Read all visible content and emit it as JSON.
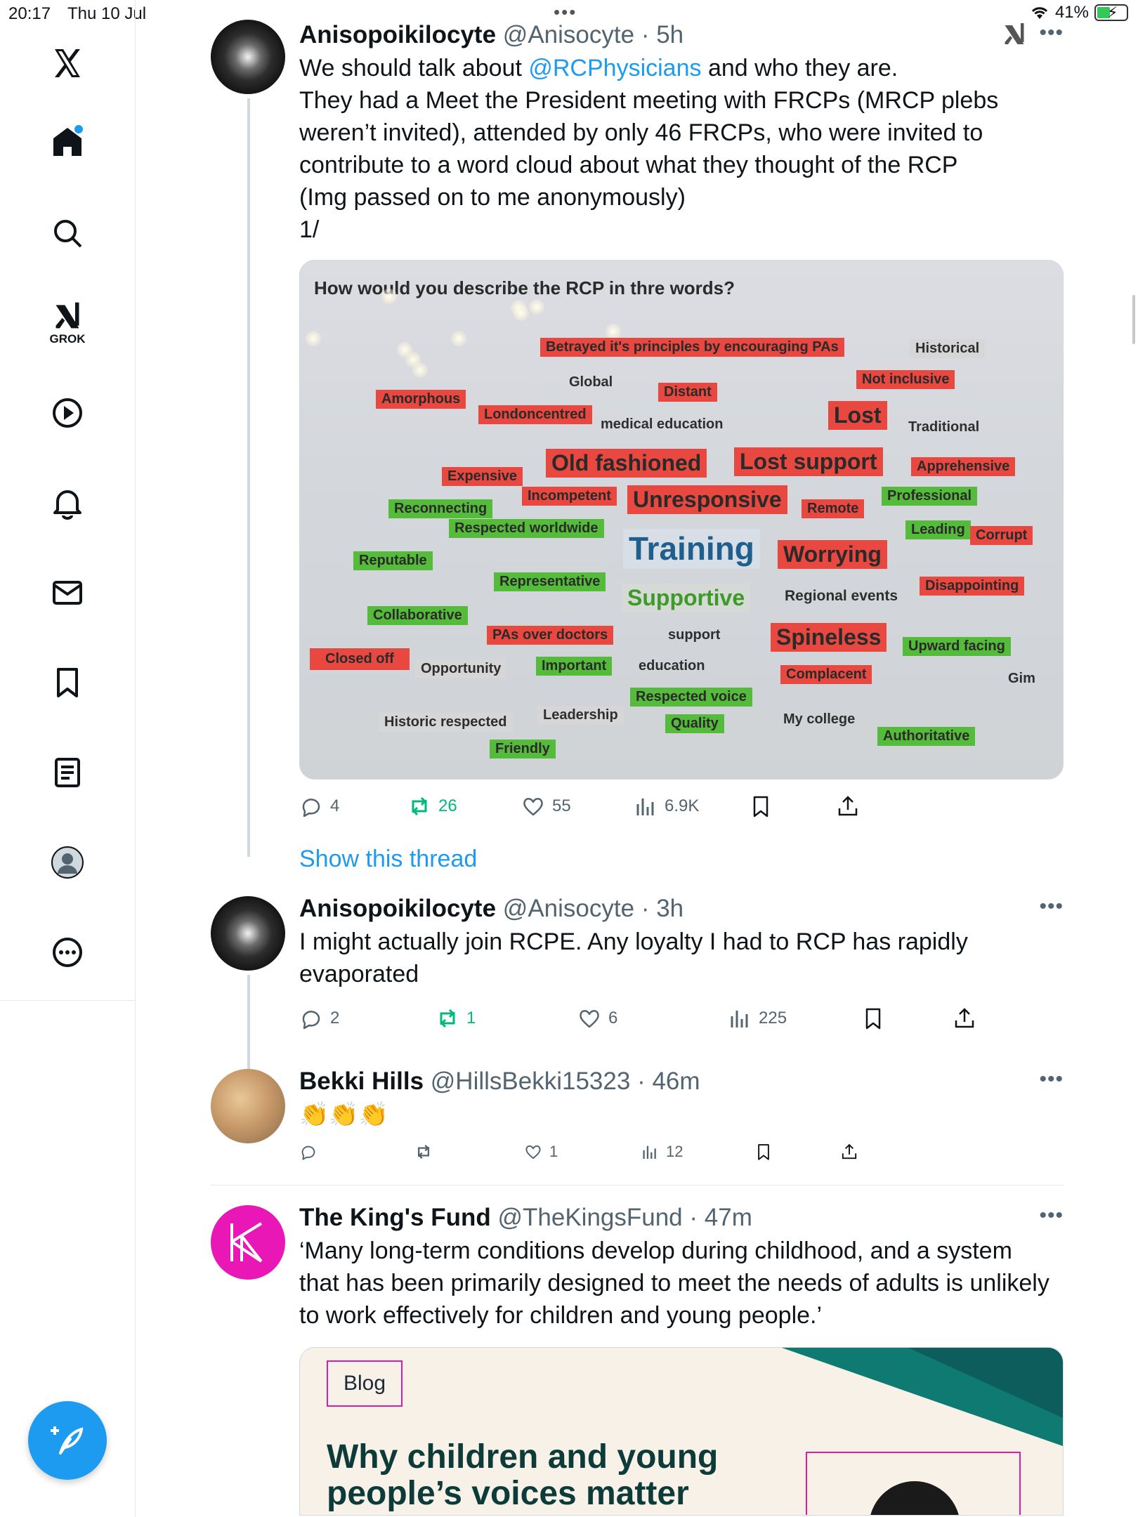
{
  "status_bar": {
    "time": "20:17",
    "date": "Thu 10 Jul",
    "battery": "41%"
  },
  "sidebar": {
    "grok_label": "GROK"
  },
  "tweets": [
    {
      "name": "Anisopoikilocyte",
      "handle": "@Anisocyte",
      "time": "· 5h",
      "text_pre": "We should talk about ",
      "mention": "@RCPhysicians",
      "text_post": " and who they are.",
      "lines": [
        "They had a Meet the President meeting with FRCPs (MRCP plebs",
        "weren’t invited), attended by only 46 FRCPs, who were invited to",
        "contribute to a word cloud about what they thought of the RCP",
        "(Img passed on to me anonymously)",
        "1/"
      ],
      "replies": "4",
      "reposts": "26",
      "likes": "55",
      "views": "6.9K"
    },
    {
      "name": "Anisopoikilocyte",
      "handle": "@Anisocyte",
      "time": "· 3h",
      "lines": [
        "I might actually join RCPE. Any loyalty I had to RCP has rapidly",
        "evaporated"
      ],
      "replies": "2",
      "reposts": "1",
      "likes": "6",
      "views": "225"
    },
    {
      "name": "Bekki Hills",
      "handle": "@HillsBekki15323",
      "time": "· 46m",
      "text": "👏👏👏",
      "likes": "1",
      "views": "12"
    },
    {
      "name": "The King's Fund",
      "handle": "@TheKingsFund",
      "time": "· 47m",
      "lines": [
        "‘Many long-term conditions develop during childhood, and a system",
        "that has been primarily designed to meet the needs of adults is unlikely",
        "to work effectively for children and young people.’"
      ],
      "card": {
        "tag": "Blog",
        "title_line1": "Why children and young",
        "title_line2": "people’s voices matter"
      }
    }
  ],
  "show_thread": "Show this thread",
  "wordcloud": {
    "question": "How would you describe the RCP in thre  words?",
    "words": [
      "Betrayed it's principles by encouraging PAs",
      "Historical",
      "Global",
      "Not inclusive",
      "Amorphous",
      "Distant",
      "Londoncentred",
      "medical education",
      "Lost",
      "Traditional",
      "Old fashioned",
      "Lost support",
      "Expensive",
      "Apprehensive",
      "Incompetent",
      "Unresponsive",
      "Reconnecting",
      "Remote",
      "Professional",
      "Respected worldwide",
      "Training",
      "Worrying",
      "Leading",
      "Corrupt",
      "Reputable",
      "Representative",
      "Supportive",
      "Regional events",
      "Disappointing",
      "Collaborative",
      "PAs over doctors",
      "support",
      "Spineless",
      "Upward facing",
      "Closed off",
      "Opportunity",
      "Important",
      "education",
      "Complacent",
      "Gim",
      "Respected voice",
      "Leadership",
      "Historic respected",
      "Quality",
      "My college",
      "Authoritative",
      "Friendly"
    ]
  }
}
